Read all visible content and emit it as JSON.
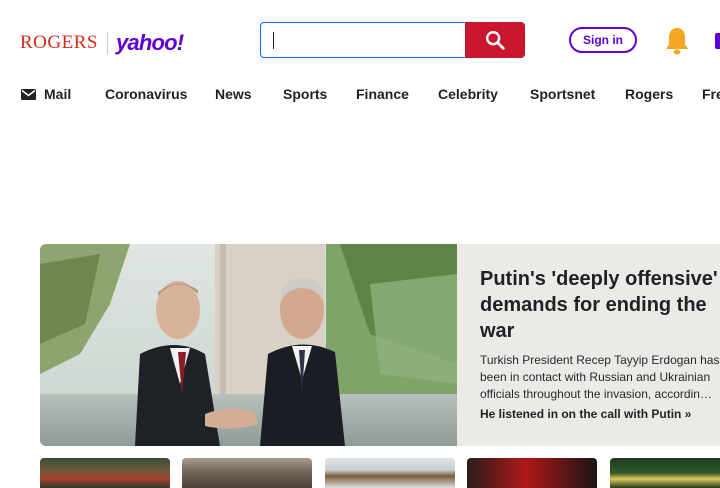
{
  "header": {
    "brand_partner": "ROGERS",
    "brand": "yahoo!",
    "search": {
      "value": "",
      "placeholder": ""
    },
    "sign_in_label": "Sign in",
    "icons": {
      "search": "search-icon",
      "notifications": "bell-icon",
      "mail": "mail-icon"
    },
    "colors": {
      "rogers_red": "#da291c",
      "yahoo_purple": "#6001d2",
      "search_button": "#c7162d",
      "bell": "#f5a623"
    }
  },
  "nav": {
    "items": [
      "Mail",
      "Coronavirus",
      "News",
      "Sports",
      "Finance",
      "Celebrity",
      "Sportsnet",
      "Rogers",
      "Fre"
    ]
  },
  "hero": {
    "title": "Putin's 'deeply offensive' demands for ending the war",
    "summary": "Turkish President Recep Tayyip Erdogan has been in contact with Russian and Ukrainian officials throughout the invasion, accordin…",
    "link": "He listened in on the call with Putin »",
    "image": "two-leaders-handshake-photo"
  },
  "thumbnails": [
    "thumbnail-1",
    "thumbnail-2",
    "thumbnail-3",
    "thumbnail-4",
    "thumbnail-5"
  ]
}
